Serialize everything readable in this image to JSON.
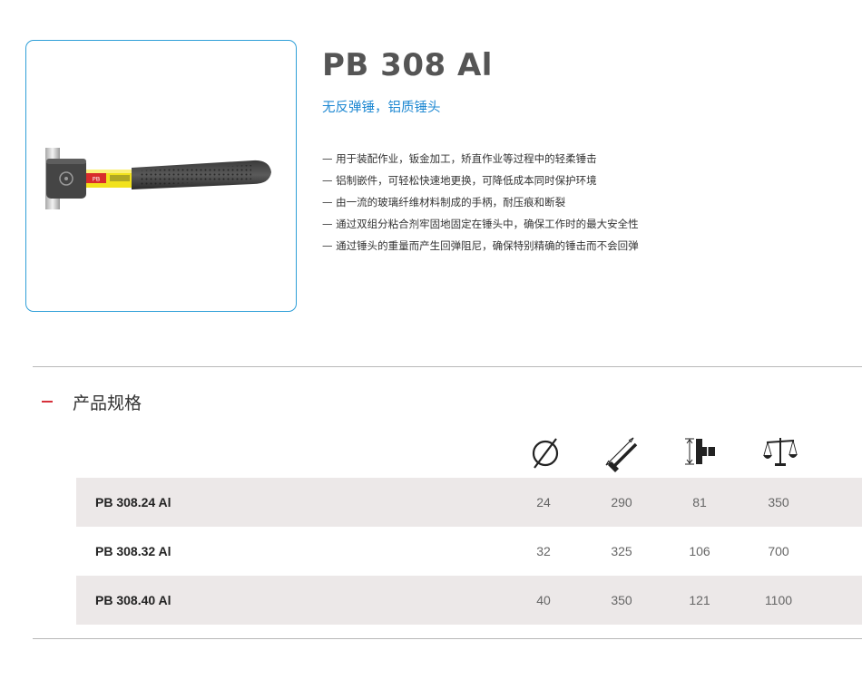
{
  "product": {
    "title": "PB 308 Al",
    "subtitle": "无反弹锤，铝质锤头",
    "image_alt": "无反弹锤",
    "features": [
      "— 用于装配作业，钣金加工，矫直作业等过程中的轻柔锤击",
      "— 铝制嵌件，可轻松快速地更换，可降低成本同时保护环境",
      "— 由一流的玻璃纤维材料制成的手柄，耐压痕和断裂",
      "— 通过双组分粘合剂牢固地固定在锤头中，确保工作时的最大安全性",
      "— 通过锤头的重量而产生回弹阻尼，确保特别精确的锤击而不会回弹"
    ]
  },
  "specs": {
    "heading": "产品规格",
    "columns": [
      {
        "icon": "diameter-icon"
      },
      {
        "icon": "length-icon"
      },
      {
        "icon": "head-length-icon"
      },
      {
        "icon": "weight-scale-icon"
      }
    ],
    "rows": [
      {
        "model": "PB 308.24 Al",
        "diameter": "24",
        "length": "290",
        "head_length": "81",
        "weight": "350"
      },
      {
        "model": "PB 308.32 Al",
        "diameter": "32",
        "length": "325",
        "head_length": "106",
        "weight": "700"
      },
      {
        "model": "PB 308.40 Al",
        "diameter": "40",
        "length": "350",
        "head_length": "121",
        "weight": "1100"
      }
    ]
  },
  "colors": {
    "accent_blue": "#1e88d2",
    "card_border": "#2f9fd8",
    "toggle_red": "#d6303a",
    "row_shade": "#ece8e8",
    "handle_yellow": "#f2e21c"
  }
}
